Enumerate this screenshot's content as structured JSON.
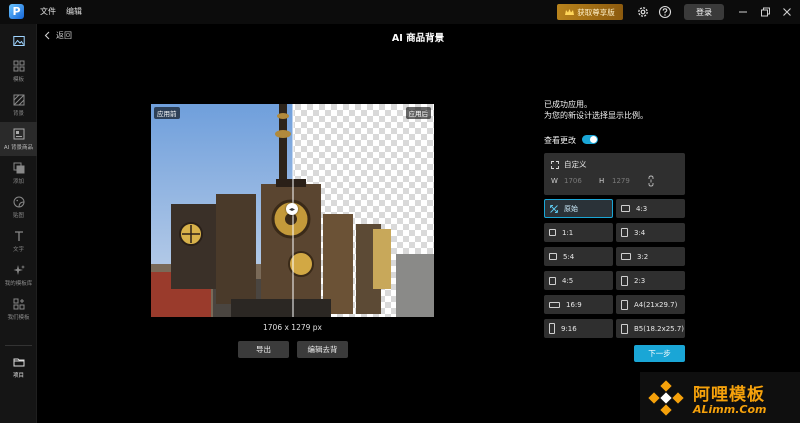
{
  "app": {
    "logo_letter": "P",
    "menu": [
      "文件",
      "编辑"
    ],
    "vip_button": "获取尊享版",
    "login_button": "登录"
  },
  "sidebar": {
    "items": [
      {
        "label": "",
        "icon": "image-icon"
      },
      {
        "label": "模板",
        "icon": "grid-icon"
      },
      {
        "label": "背景",
        "icon": "background-icon"
      },
      {
        "label": "AI 背景商品",
        "icon": "ai-background-icon"
      },
      {
        "label": "添加",
        "icon": "layers-icon"
      },
      {
        "label": "贴图",
        "icon": "sticker-icon"
      },
      {
        "label": "文字",
        "icon": "text-icon"
      },
      {
        "label": "我的模板库",
        "icon": "sparkle-icon"
      },
      {
        "label": "我们模板",
        "icon": "template-plus-icon"
      },
      {
        "label": "项目",
        "icon": "folder-icon"
      }
    ]
  },
  "header": {
    "back_label": "返回",
    "title": "AI 商品背景"
  },
  "preview": {
    "tag_before": "应用前",
    "tag_after": "应用后",
    "dimensions": "1706 x 1279 px",
    "export_button": "导出",
    "edit_button": "编辑去背"
  },
  "panel": {
    "success_line1": "已成功应用。",
    "success_line2": "为您的新设计选择显示比例。",
    "view_changes": "查看更改",
    "view_changes_on": true,
    "custom": {
      "title": "自定义",
      "w_label": "W",
      "w_value": "1706",
      "h_label": "H",
      "h_value": "1279"
    },
    "ratios": [
      {
        "label": "原始",
        "selected": true
      },
      {
        "label": "4:3",
        "selected": false
      },
      {
        "label": "1:1",
        "selected": false
      },
      {
        "label": "3:4",
        "selected": false
      },
      {
        "label": "5:4",
        "selected": false
      },
      {
        "label": "3:2",
        "selected": false
      },
      {
        "label": "4:5",
        "selected": false
      },
      {
        "label": "2:3",
        "selected": false
      },
      {
        "label": "16:9",
        "selected": false
      },
      {
        "label": "A4(21x29.7)",
        "selected": false
      },
      {
        "label": "9:16",
        "selected": false
      },
      {
        "label": "B5(18.2x25.7)",
        "selected": false
      }
    ],
    "next_button": "下一步"
  },
  "watermark": {
    "text_cn": "阿哩模板",
    "text_en": "ALimm.Com"
  },
  "colors": {
    "accent": "#1aa6d6",
    "vip_gold": "#b8831c",
    "watermark_orange": "#f5a10b"
  }
}
